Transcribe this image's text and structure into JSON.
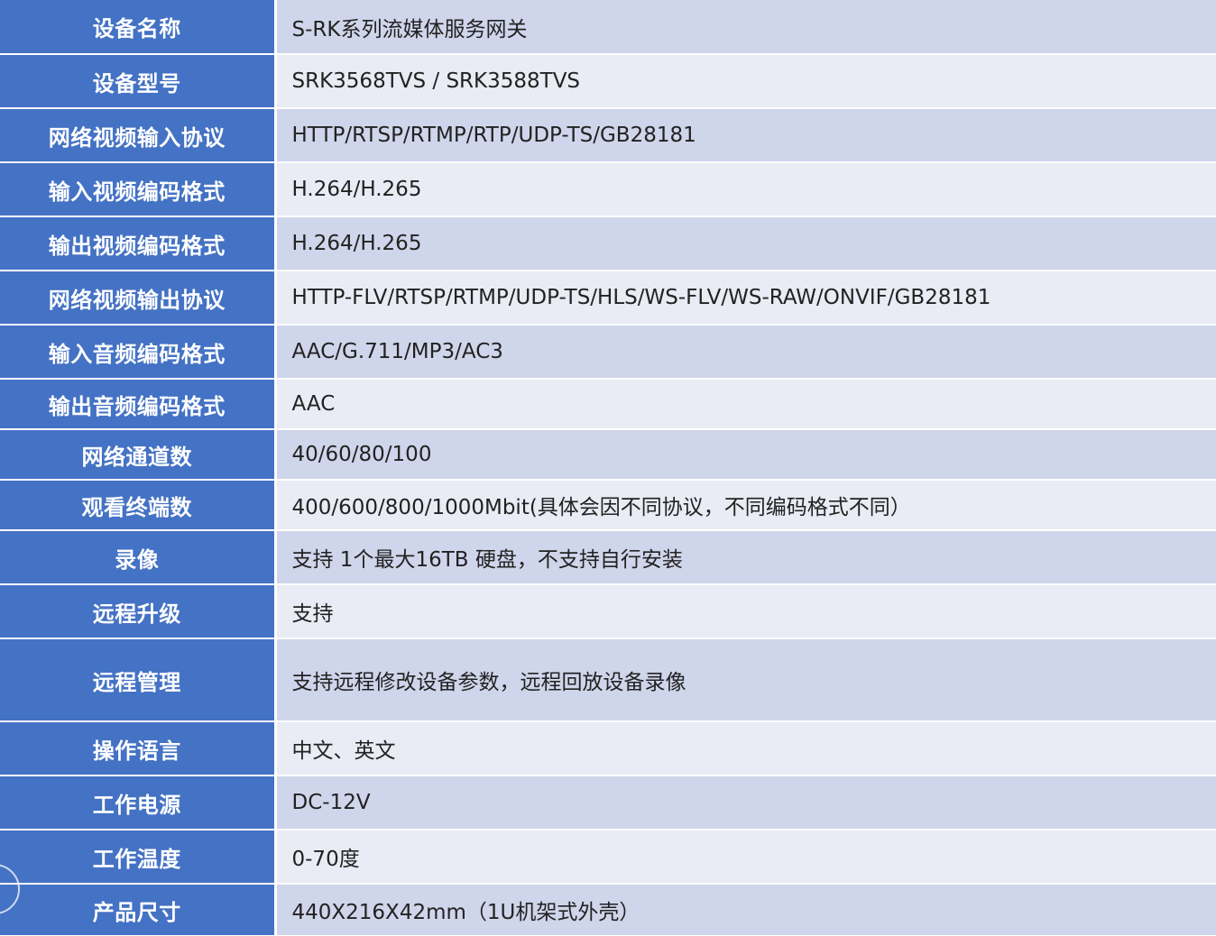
{
  "rows": [
    {
      "label": "设备名称",
      "value": "S-RK系列流媒体服务网关"
    },
    {
      "label": "设备型号",
      "value": "SRK3568TVS / SRK3588TVS"
    },
    {
      "label": "网络视频输入协议",
      "value": "HTTP/RTSP/RTMP/RTP/UDP-TS/GB28181"
    },
    {
      "label": "输入视频编码格式",
      "value": "H.264/H.265"
    },
    {
      "label": "输出视频编码格式",
      "value": "H.264/H.265"
    },
    {
      "label": "网络视频输出协议",
      "value": "HTTP-FLV/RTSP/RTMP/UDP-TS/HLS/WS-FLV/WS-RAW/ONVIF/GB28181"
    },
    {
      "label": "输入音频编码格式",
      "value": "AAC/G.711/MP3/AC3"
    },
    {
      "label": "输出音频编码格式",
      "value": "AAC"
    },
    {
      "label": "网络通道数",
      "value": "40/60/80/100"
    },
    {
      "label": "观看终端数",
      "value": "400/600/800/1000Mbit(具体会因不同协议，不同编码格式不同）"
    },
    {
      "label": "录像",
      "value": "支持 1个最大16TB 硬盘，不支持自行安装"
    },
    {
      "label": "远程升级",
      "value": "支持"
    },
    {
      "label": "远程管理",
      "value": "支持远程修改设备参数，远程回放设备录像"
    },
    {
      "label": "操作语言",
      "value": "中文、英文"
    },
    {
      "label": "工作电源",
      "value": "DC-12V"
    },
    {
      "label": "工作温度",
      "value": "0-70度"
    },
    {
      "label": "产品尺寸",
      "value": "440X216X42mm（1U机架式外壳）"
    }
  ],
  "colors": {
    "label_bg": "#4472c4",
    "label_text": "#ffffff",
    "row_odd_bg": "#cfd5ea",
    "row_even_bg": "#e9ebf5",
    "value_text": "#222222"
  }
}
